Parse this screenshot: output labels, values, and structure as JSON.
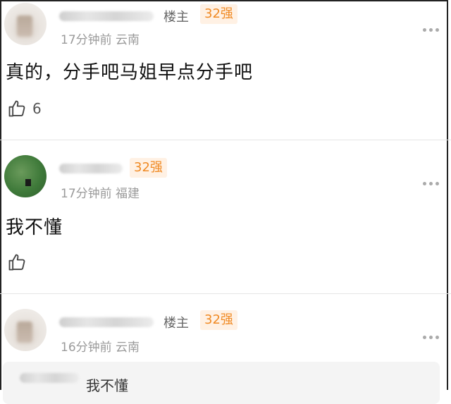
{
  "comments": [
    {
      "badge_op": "楼主",
      "level": "32强",
      "time": "17分钟前",
      "location": "云南",
      "text": "真的，分手吧马姐早点分手吧",
      "likes": "6"
    },
    {
      "level": "32强",
      "time": "17分钟前",
      "location": "福建",
      "text": "我不懂",
      "likes": ""
    },
    {
      "badge_op": "楼主",
      "level": "32强",
      "time": "16分钟前",
      "location": "云南",
      "quoted_reply": "我不懂"
    }
  ],
  "icons": {
    "like": "thumbs-up-icon",
    "more": "more-options-icon"
  }
}
